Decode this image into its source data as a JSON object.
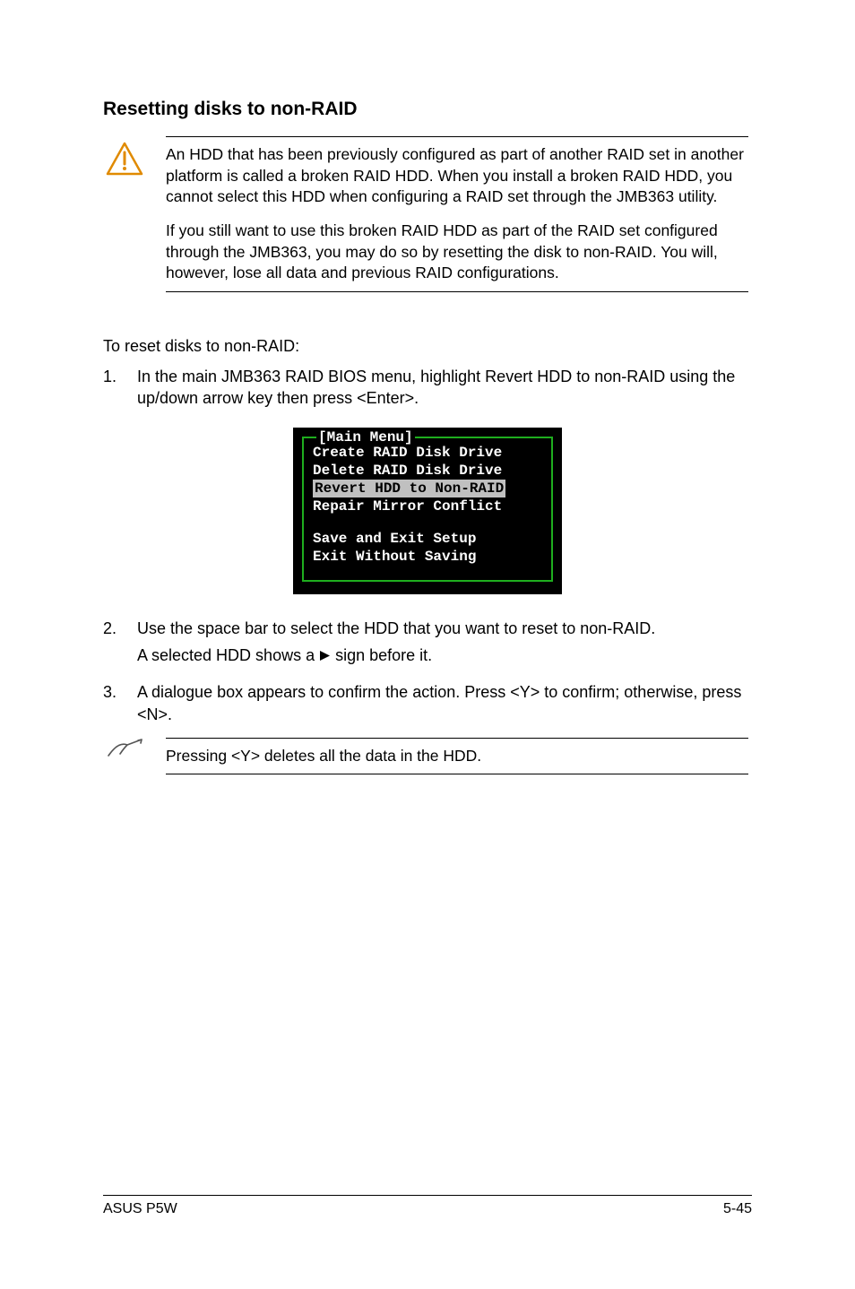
{
  "heading": "Resetting disks to non-RAID",
  "warning": {
    "p1": "An HDD that has been previously configured as part of another RAID set in another platform is called a broken RAID HDD. When you install a broken RAID HDD, you cannot select this HDD when configuring a RAID set through the JMB363 utility.",
    "p2": "If you still want to use this broken RAID HDD as part of the RAID set configured through the JMB363, you may do so by resetting the disk to non-RAID. You will, however, lose all data and previous RAID configurations."
  },
  "intro": "To reset disks to non-RAID:",
  "steps": {
    "s1_num": "1.",
    "s1": "In the main JMB363 RAID BIOS menu, highlight Revert HDD to non-RAID using the up/down arrow key then press <Enter>.",
    "s2_num": "2.",
    "s2a": "Use the space bar to select the HDD that you want to reset to non-RAID.",
    "s2b_pre": "A selected HDD shows a ",
    "s2b_post": " sign before it.",
    "s3_num": "3.",
    "s3": "A dialogue box appears to confirm the action. Press <Y> to confirm; otherwise, press <N>."
  },
  "bios": {
    "title": "[Main Menu]",
    "l1": "Create RAID Disk Drive",
    "l2": "Delete RAID Disk Drive",
    "l3": "Revert HDD to Non-RAID",
    "l4": "Repair Mirror Conflict",
    "l5": "Save and Exit Setup",
    "l6": "Exit Without Saving"
  },
  "note": "Pressing <Y> deletes all the data in the HDD.",
  "footer": {
    "left": "ASUS P5W",
    "right": "5-45"
  }
}
